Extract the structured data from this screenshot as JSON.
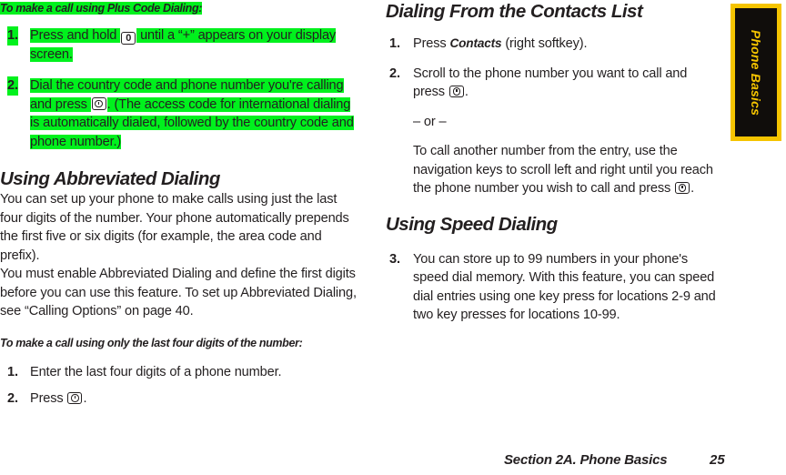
{
  "document": {
    "footer_section": "Section 2A. Phone Basics",
    "footer_page": "25",
    "side_tab_label": "Phone Basics",
    "highlight_color": "#00f11d",
    "tab_bg_color": "#100d0b",
    "tab_border_color": "#f5c400"
  },
  "left_column": {
    "proc_heading_1": "To make a call using Plus Code Dialing:",
    "steps_1": [
      {
        "num": "1.",
        "text_a": "Press and hold ",
        "key": "0",
        "text_b": " until a “+” appears on your display screen."
      },
      {
        "num": "2.",
        "text_a": "Dial the country code and phone number you're calling and press ",
        "key": "talk",
        "text_b": ". (The access code for international dialing is automatically dialed, followed by the country code and phone number.)"
      }
    ],
    "section_heading": "Using Abbreviated Dialing",
    "paragraph_1": "You can set up your phone to make calls using just the last four digits of the number. Your phone automatically prepends the first five or six digits (for example, the area code and prefix).",
    "paragraph_2": "You must enable Abbreviated Dialing and define the first digits before you can use this feature. To set up Abbreviated Dialing, see “Calling Options” on page 40.",
    "proc_heading_2": "To make a call using only the last four digits of the number:",
    "steps_2": [
      {
        "num": "1.",
        "text_a": "Enter the last four digits of a phone number.",
        "key": "",
        "text_b": ""
      },
      {
        "num": "2.",
        "text_a": "Press ",
        "key": "talk",
        "text_b": "."
      }
    ]
  },
  "right_column": {
    "section_heading_1": "Dialing From the Contacts List",
    "steps_1": [
      {
        "num": "1.",
        "text_a": "Press ",
        "emph": "Contacts",
        "text_b": " (right softkey).",
        "key": ""
      },
      {
        "num": "2.",
        "text_a": "Scroll to the phone number you want to call and press ",
        "key": "talk",
        "text_b": "."
      }
    ],
    "or_divider": "– or –",
    "sub_paragraph": "To call another number from the entry, use the navigation keys to scroll left and right until you reach the phone number you wish to call and press ",
    "sub_paragraph_key": "talk",
    "sub_paragraph_end": ".",
    "section_heading_2": "Using Speed Dialing",
    "steps_2": [
      {
        "num": "3.",
        "text_a": "You can store up to 99 numbers in your phone's speed dial memory. With this feature, you can speed dial entries using one key press for locations 2-9 and two key presses for locations 10-99.",
        "key": "",
        "text_b": ""
      }
    ]
  }
}
